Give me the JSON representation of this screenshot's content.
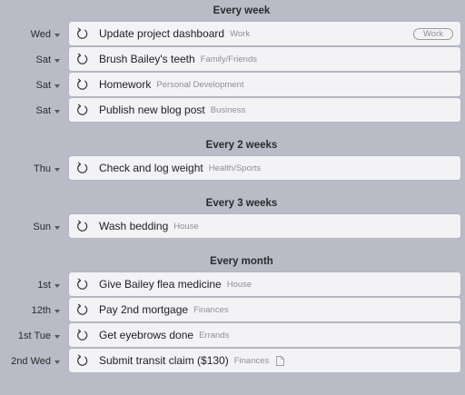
{
  "sections": [
    {
      "title": "Every week",
      "tasks": [
        {
          "day": "Wed",
          "title": "Update project dashboard",
          "category": "Work",
          "tag": "Work"
        },
        {
          "day": "Sat",
          "title": "Brush Bailey's teeth",
          "category": "Family/Friends"
        },
        {
          "day": "Sat",
          "title": "Homework",
          "category": "Personal Development"
        },
        {
          "day": "Sat",
          "title": "Publish new blog post",
          "category": "Business"
        }
      ]
    },
    {
      "title": "Every 2 weeks",
      "tasks": [
        {
          "day": "Thu",
          "title": "Check and log weight",
          "category": "Health/Sports"
        }
      ]
    },
    {
      "title": "Every 3 weeks",
      "tasks": [
        {
          "day": "Sun",
          "title": "Wash bedding",
          "category": "House"
        }
      ]
    },
    {
      "title": "Every month",
      "tasks": [
        {
          "day": "1st",
          "title": "Give Bailey flea medicine",
          "category": "House"
        },
        {
          "day": "12th",
          "title": "Pay 2nd mortgage",
          "category": "Finances"
        },
        {
          "day": "1st Tue",
          "title": "Get eyebrows done",
          "category": "Errands"
        },
        {
          "day": "2nd Wed",
          "title": "Submit transit claim ($130)",
          "category": "Finances",
          "has_note": true
        }
      ]
    }
  ],
  "icons": {
    "repeat": "repeat-icon",
    "note": "note-icon",
    "dropdown": "chevron-down-icon"
  },
  "colors": {
    "background": "#b9bcc6",
    "card": "#f3f3f5",
    "category_text": "#8e8f95"
  }
}
